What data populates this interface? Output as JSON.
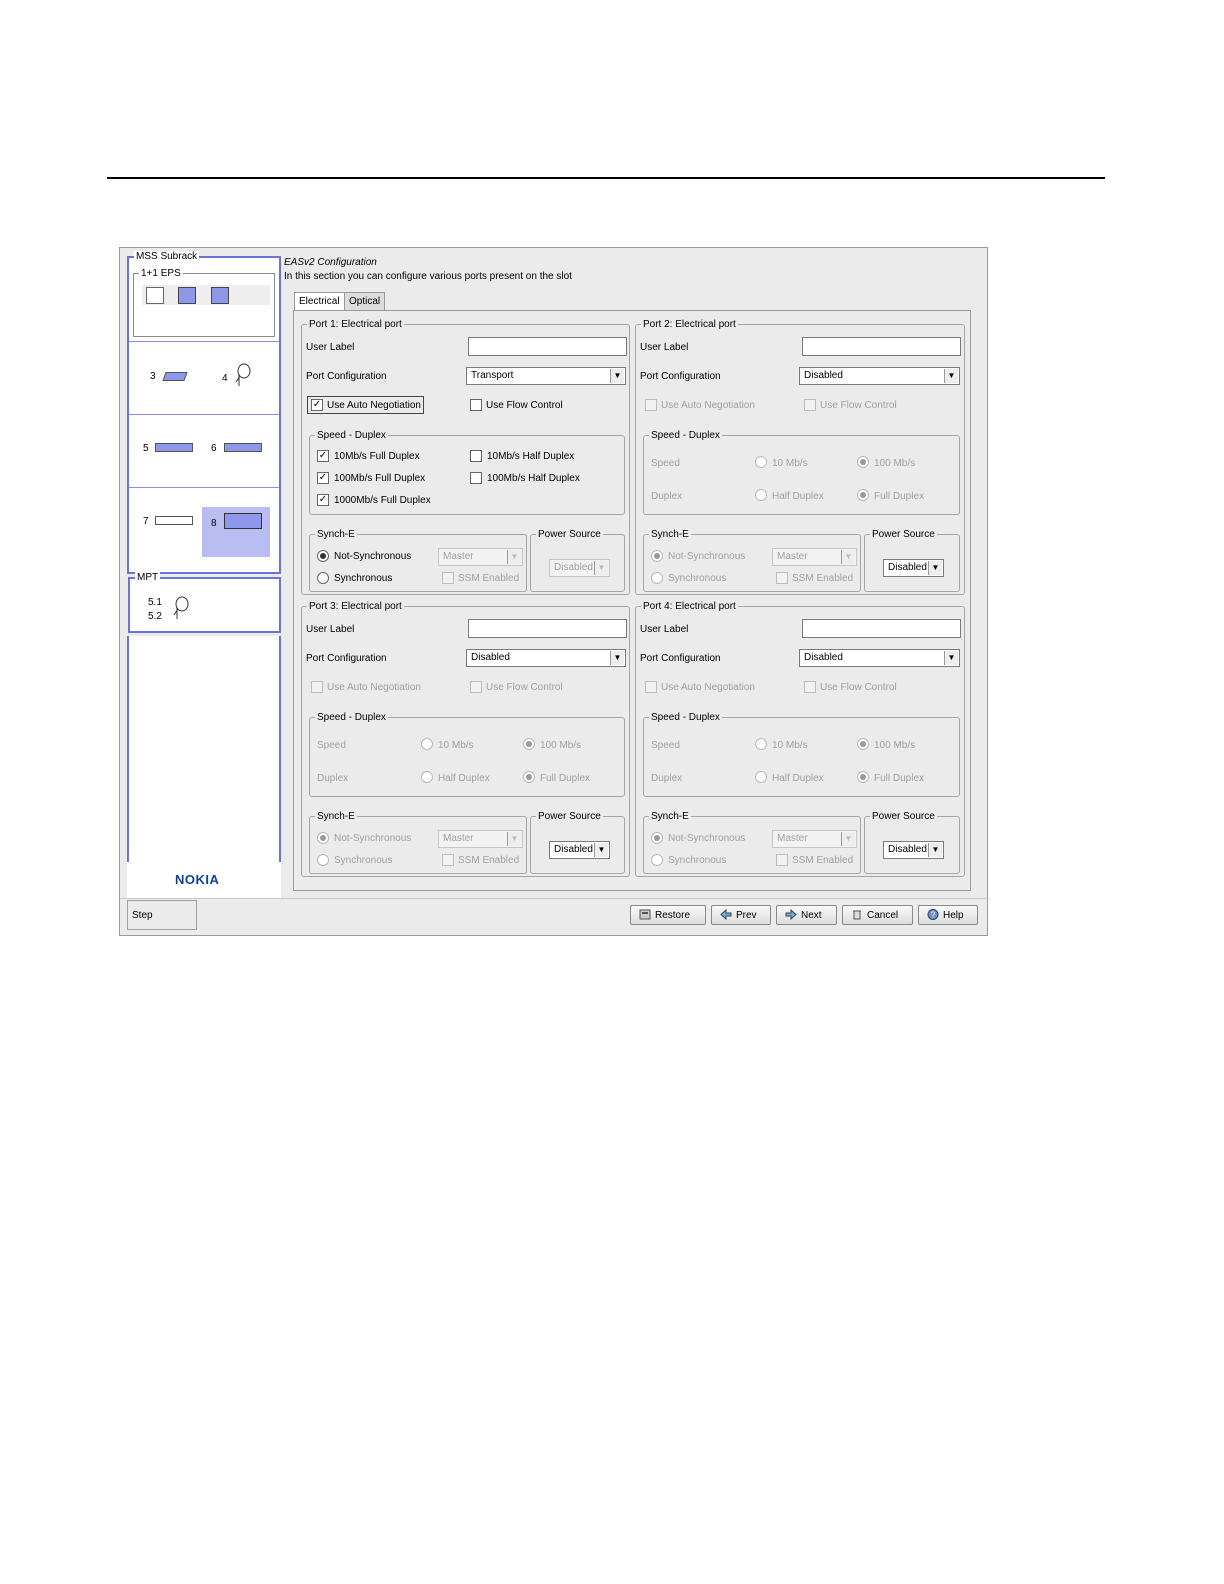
{
  "sidebar": {
    "mss_subrack_title": "MSS Subrack",
    "eps_title": "1+1 EPS",
    "slots": {
      "s3": "3",
      "s4": "4",
      "s5": "5",
      "s6": "6",
      "s7": "7",
      "s8": "8"
    },
    "mpt_title": "MPT",
    "mpt_items": [
      "5.1",
      "5.2"
    ],
    "logo": "NOKIA",
    "step_label": "Step"
  },
  "header": {
    "title": "EASv2 Configuration",
    "subtitle": "In this section you can configure various ports present on the slot"
  },
  "tabs": [
    {
      "label": "Electrical"
    },
    {
      "label": "Optical"
    }
  ],
  "labels": {
    "user_label": "User Label",
    "port_configuration": "Port Configuration",
    "use_auto_negotiation": "Use Auto Negotiation",
    "use_flow_control": "Use Flow Control",
    "speed_duplex": "Speed - Duplex",
    "speed": "Speed",
    "duplex": "Duplex",
    "speed_10": "10 Mb/s",
    "speed_100": "100 Mb/s",
    "half_duplex": "Half Duplex",
    "full_duplex": "Full Duplex",
    "synch_e": "Synch-E",
    "not_synchronous": "Not-Synchronous",
    "synchronous": "Synchronous",
    "master": "Master",
    "ssm_enabled": "SSM Enabled",
    "power_source": "Power Source"
  },
  "port1": {
    "title": "Port 1: Electrical port",
    "user_label_value": "",
    "port_configuration": "Transport",
    "auto_negotiation": true,
    "flow_control": false,
    "speed_options": [
      {
        "label": "10Mb/s Full Duplex",
        "checked": true
      },
      {
        "label": "10Mb/s Half Duplex",
        "checked": false
      },
      {
        "label": "100Mb/s Full Duplex",
        "checked": true
      },
      {
        "label": "100Mb/s Half Duplex",
        "checked": false
      },
      {
        "label": "1000Mb/s Full Duplex",
        "checked": true
      }
    ],
    "synch_mode": "Not-Synchronous",
    "power_source": "Disabled"
  },
  "port2": {
    "title": "Port 2: Electrical port",
    "user_label_value": "",
    "port_configuration": "Disabled",
    "power_source": "Disabled"
  },
  "port3": {
    "title": "Port 3: Electrical port",
    "user_label_value": "",
    "port_configuration": "Disabled",
    "power_source": "Disabled"
  },
  "port4": {
    "title": "Port 4: Electrical port",
    "user_label_value": "",
    "port_configuration": "Disabled",
    "power_source": "Disabled"
  },
  "buttons": {
    "restore": "Restore",
    "prev": "Prev",
    "next": "Next",
    "cancel": "Cancel",
    "help": "Help"
  },
  "colors": {
    "sidebar_border": "#6b73d8",
    "selected_slot": "#b9bdf2",
    "module_fill": "#8f97ea",
    "nokia_blue": "#124191"
  }
}
